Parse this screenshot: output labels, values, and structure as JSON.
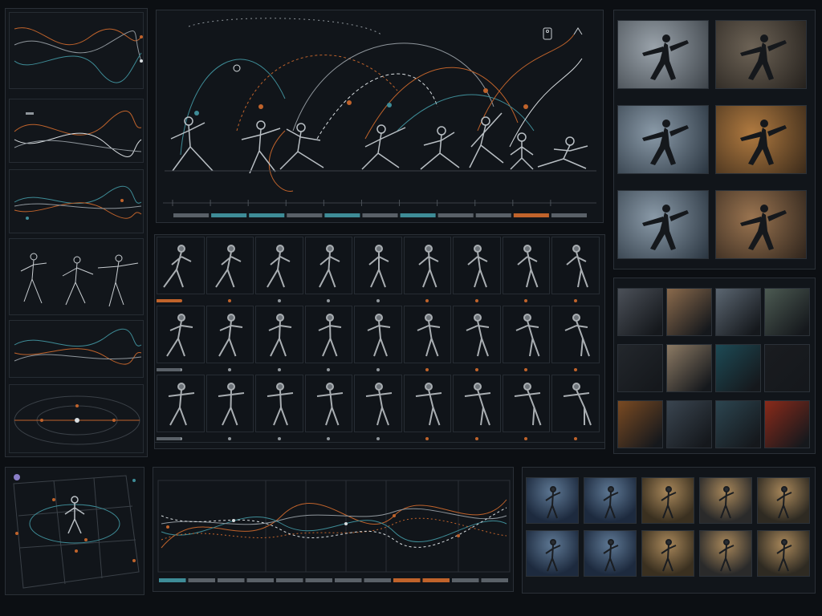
{
  "colors": {
    "background": "#0c0f13",
    "panel": "#11151a",
    "border": "#2a3037",
    "accent_orange": "#c0632b",
    "accent_teal": "#3e8c97",
    "neutral": "#8f969c",
    "figure": "#a9aeb2"
  },
  "icons": {
    "figure_icon": "figure-icon",
    "arrow_icon": "arrow-icon"
  },
  "timeline_segments": [
    {
      "color": "#5a6168"
    },
    {
      "color": "#3e8c97"
    },
    {
      "color": "#3e8c97"
    },
    {
      "color": "#5a6168"
    },
    {
      "color": "#3e8c97"
    },
    {
      "color": "#5a6168"
    },
    {
      "color": "#3e8c97"
    },
    {
      "color": "#5a6168"
    },
    {
      "color": "#5a6168"
    },
    {
      "color": "#c0632b"
    },
    {
      "color": "#5a6168"
    }
  ],
  "bottom_timeline_segments": [
    {
      "color": "#3e8c97"
    },
    {
      "color": "#5a6168"
    },
    {
      "color": "#5a6168"
    },
    {
      "color": "#5a6168"
    },
    {
      "color": "#5a6168"
    },
    {
      "color": "#5a6168"
    },
    {
      "color": "#5a6168"
    },
    {
      "color": "#5a6168"
    },
    {
      "color": "#c0632b"
    },
    {
      "color": "#c0632b"
    },
    {
      "color": "#5a6168"
    },
    {
      "color": "#5a6168"
    }
  ],
  "pose_rows": [
    {
      "marker_colors": [
        "#c0632b",
        "#c0632b",
        "#8f969c",
        "#8f969c",
        "#8f969c",
        "#c0632b",
        "#c0632b",
        "#c0632b",
        "#c0632b"
      ]
    },
    {
      "marker_colors": [
        "#8f969c",
        "#8f969c",
        "#8f969c",
        "#8f969c",
        "#8f969c",
        "#c0632b",
        "#c0632b",
        "#c0632b",
        "#c0632b"
      ]
    },
    {
      "marker_colors": [
        "#8f969c",
        "#8f969c",
        "#8f969c",
        "#8f969c",
        "#8f969c",
        "#c0632b",
        "#c0632b",
        "#c0632b",
        "#c0632b"
      ]
    }
  ],
  "reference_thumbs": [
    {
      "tone": "cool-grey"
    },
    {
      "tone": "warm-grey"
    },
    {
      "tone": "cool-blue"
    },
    {
      "tone": "warm-orange"
    },
    {
      "tone": "cool-blue"
    },
    {
      "tone": "warm-brown"
    }
  ],
  "material_swatches": [
    {
      "color": "#4b5058"
    },
    {
      "color": "#8a6a4c"
    },
    {
      "color": "#5b6671"
    },
    {
      "color": "#4c5a52"
    },
    {
      "color": "#23272c"
    },
    {
      "color": "#8c7a64"
    },
    {
      "color": "#1d4a55"
    },
    {
      "color": "#1a1c20"
    },
    {
      "color": "#7a4a22"
    },
    {
      "color": "#3a4550"
    },
    {
      "color": "#2c4550"
    },
    {
      "color": "#8a2a1a"
    }
  ],
  "lighting_thumbs": [
    {
      "tone": "#1d2a3e"
    },
    {
      "tone": "#1d2a3e"
    },
    {
      "tone": "#3a3020"
    },
    {
      "tone": "#2a2a2a"
    },
    {
      "tone": "#2e2a22"
    },
    {
      "tone": "#1d2a3e"
    },
    {
      "tone": "#1d2a3e"
    },
    {
      "tone": "#3a3020"
    },
    {
      "tone": "#2a2a2a"
    },
    {
      "tone": "#2e2a22"
    }
  ]
}
